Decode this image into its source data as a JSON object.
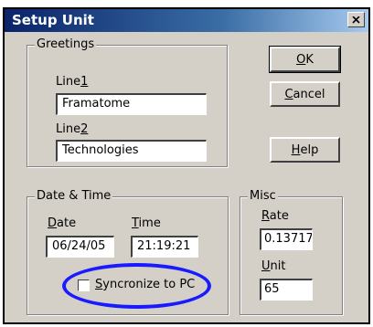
{
  "window": {
    "title": "Setup Unit",
    "close_glyph": "×"
  },
  "greetings": {
    "legend": "Greetings",
    "line1_label": "Line1",
    "line1_value": "Framatome",
    "line2_label": "Line2",
    "line2_value": "Technologies"
  },
  "buttons": {
    "ok": "OK",
    "cancel": "Cancel",
    "help": "Help"
  },
  "datetime": {
    "legend": "Date & Time",
    "date_label": "Date",
    "date_value": "06/24/05",
    "time_label": "Time",
    "time_value": "21:19:21",
    "sync_label": "Syncronize to PC",
    "sync_checked": false
  },
  "misc": {
    "legend": "Misc",
    "rate_label": "Rate",
    "rate_value": "0.13717",
    "unit_label": "Unit",
    "unit_value": "65"
  },
  "annotation": {
    "ellipse_color": "#1a1aff"
  },
  "colors": {
    "dialog_bg": "#d4d0c8",
    "title_start": "#0a246a",
    "title_end": "#a6caf0"
  }
}
